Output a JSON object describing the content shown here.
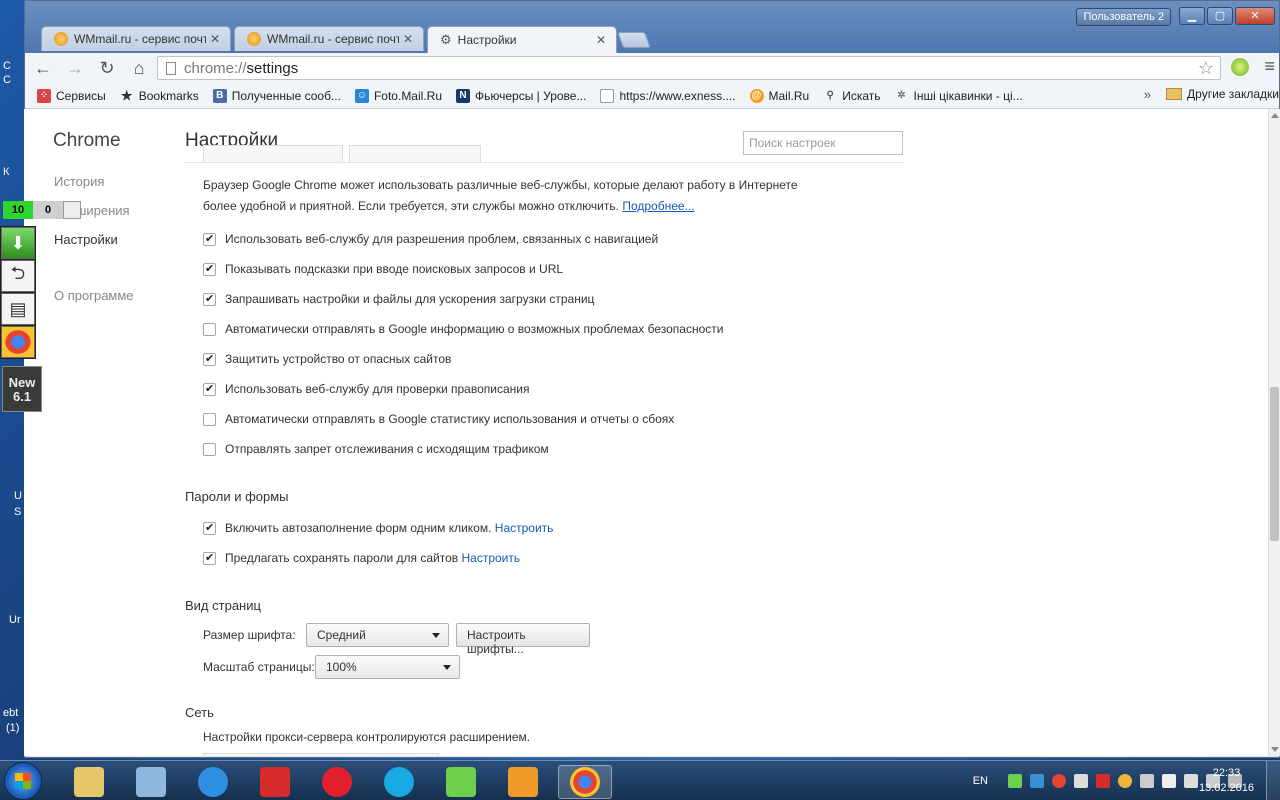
{
  "desktop": {
    "left_labels": [
      "C",
      "C",
      "К",
      "U",
      "S",
      "Ur",
      "ebt",
      "(1)"
    ]
  },
  "window": {
    "user_button": "Пользователь 2",
    "tabs": [
      {
        "title": "WMmail.ru - сервис почто",
        "active": false
      },
      {
        "title": "WMmail.ru - сервис почто",
        "active": false
      },
      {
        "title": "Настройки",
        "active": true
      }
    ],
    "address": {
      "scheme": "chrome://",
      "path": "settings"
    },
    "bookmarks": [
      {
        "label": "Сервисы",
        "icon": "apps-icon"
      },
      {
        "label": "Bookmarks",
        "icon": "star-icon"
      },
      {
        "label": "Полученные сооб...",
        "icon": "vk-icon"
      },
      {
        "label": "Foto.Mail.Ru",
        "icon": "foto-mail-icon"
      },
      {
        "label": "Фьючерсы | Урове...",
        "icon": "chart-icon"
      },
      {
        "label": "https://www.exness....",
        "icon": "page-icon"
      },
      {
        "label": "Mail.Ru",
        "icon": "mailru-icon"
      },
      {
        "label": "Искать",
        "icon": "search-icon"
      },
      {
        "label": "Інші цікавинки - ці...",
        "icon": "gear-icon"
      }
    ],
    "bookmarks_more": "»",
    "other_bookmarks": "Другие закладки"
  },
  "sidebar": {
    "brand": "Chrome",
    "items": [
      "История",
      "Расширения",
      "Настройки",
      "О программе"
    ],
    "selected": "Настройки"
  },
  "settings": {
    "title": "Настройки",
    "search_placeholder": "Поиск настроек",
    "privacy_desc": "Браузер Google Chrome может использовать различные веб-службы, которые делают работу в Интернете более удобной и приятной. Если требуется, эти службы можно отключить.",
    "privacy_link": "Подробнее...",
    "privacy_checks": [
      {
        "label": "Использовать веб-службу для разрешения проблем, связанных с навигацией",
        "checked": true
      },
      {
        "label": "Показывать подсказки при вводе поисковых запросов и URL",
        "checked": true
      },
      {
        "label": "Запрашивать настройки и файлы для ускорения загрузки страниц",
        "checked": true
      },
      {
        "label": "Автоматически отправлять в Google информацию о возможных проблемах безопасности",
        "checked": false
      },
      {
        "label": "Защитить устройство от опасных сайтов",
        "checked": true
      },
      {
        "label": "Использовать веб-службу для проверки правописания",
        "checked": true
      },
      {
        "label": "Автоматически отправлять в Google статистику использования и отчеты о сбоях",
        "checked": false
      },
      {
        "label": "Отправлять запрет отслеживания с исходящим трафиком",
        "checked": false
      }
    ],
    "passwords": {
      "title": "Пароли и формы",
      "autofill": {
        "label": "Включить автозаполнение форм одним кликом.",
        "link": "Настроить",
        "checked": true
      },
      "save_passwords": {
        "label": "Предлагать сохранять пароли для сайтов",
        "link": "Настроить",
        "checked": true
      }
    },
    "appearance": {
      "title": "Вид страниц",
      "font_size_label": "Размер шрифта:",
      "font_size_value": "Средний",
      "customize_fonts": "Настроить шрифты...",
      "zoom_label": "Масштаб страницы:",
      "zoom_value": "100%"
    },
    "network": {
      "title": "Сеть",
      "proxy_desc": "Настройки прокси-сервера контролируются расширением."
    }
  },
  "overlay": {
    "counter_green": "10",
    "counter_gray": "0",
    "new_label_1": "New",
    "new_label_2": "6.1"
  },
  "taskbar": {
    "lang": "EN",
    "time": "22:33",
    "date": "13.02.2016"
  }
}
